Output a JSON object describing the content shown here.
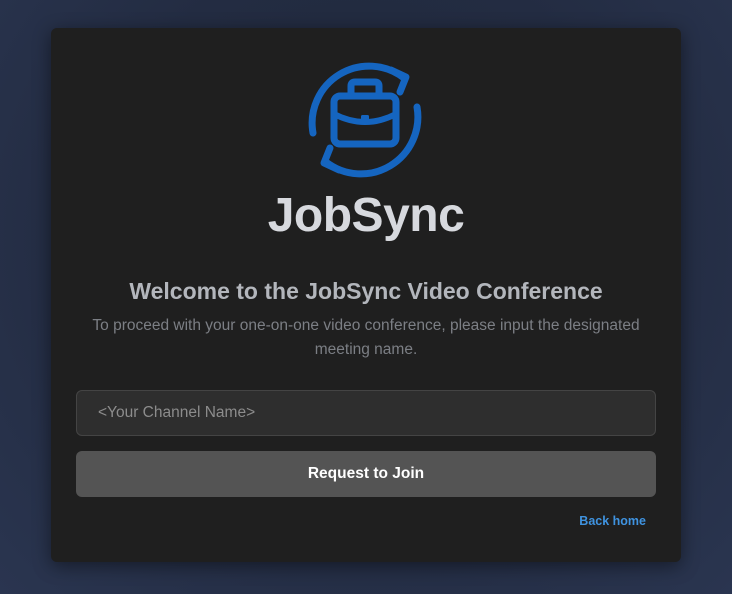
{
  "brand": {
    "name": "JobSync",
    "logo_icon": "briefcase-sync-icon",
    "accent_color": "#1565c0"
  },
  "welcome": {
    "title": "Welcome to the JobSync Video Conference",
    "subtitle": "To proceed with your one-on-one video conference, please input the designated meeting name."
  },
  "form": {
    "channel_placeholder": "<Your Channel Name>",
    "channel_value": "",
    "join_label": "Request to Join"
  },
  "links": {
    "back_home": "Back home",
    "link_color": "#3f93e0"
  }
}
